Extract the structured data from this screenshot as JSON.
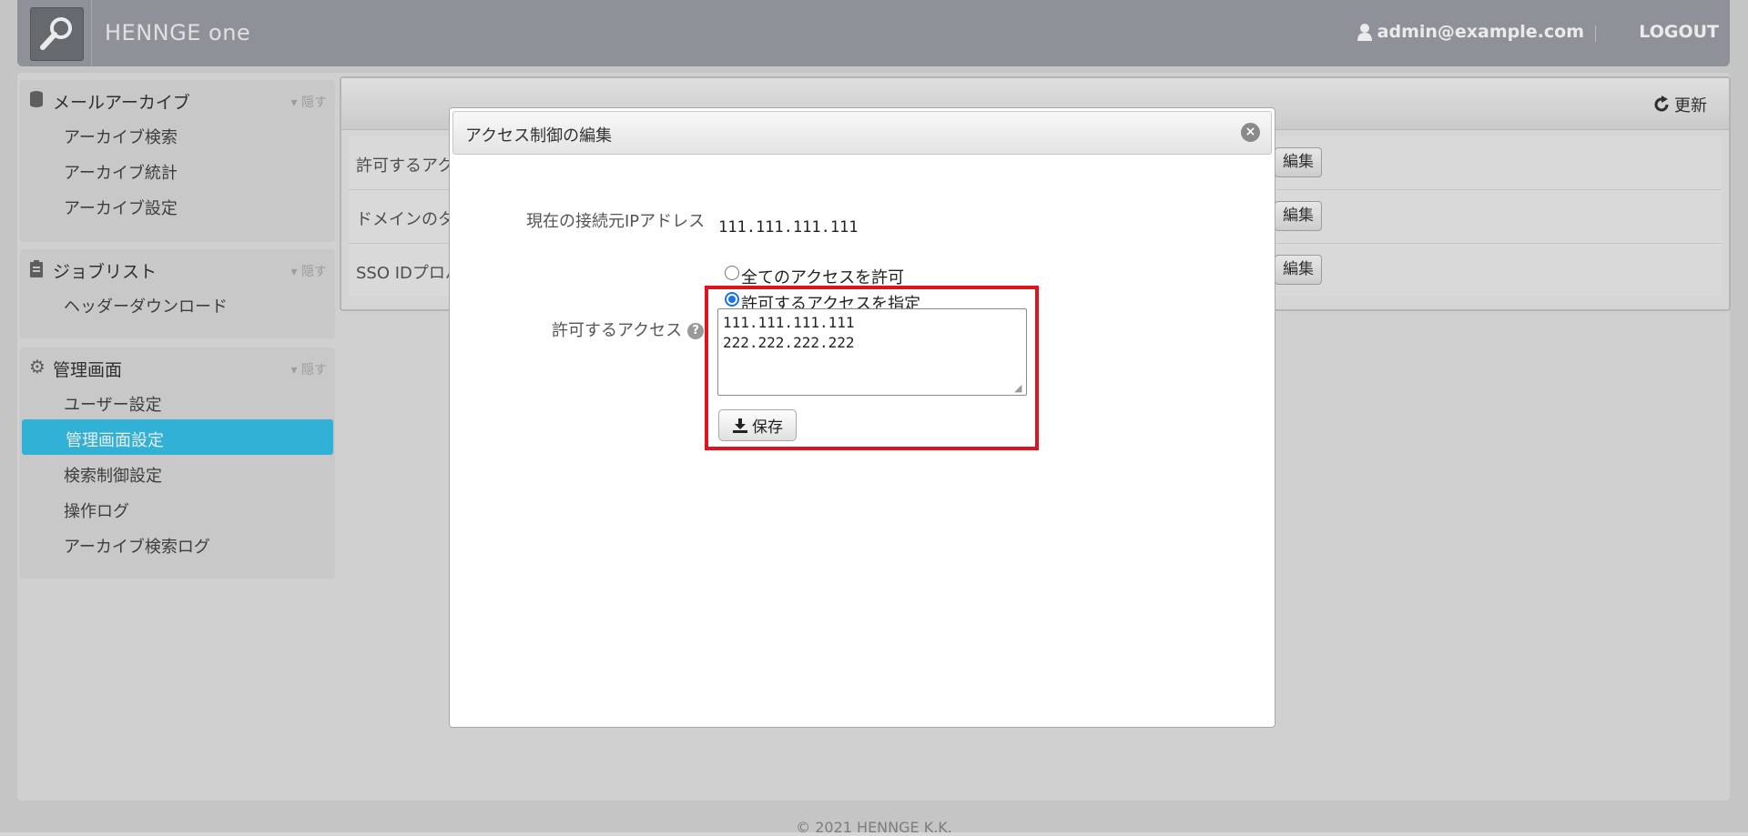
{
  "header": {
    "brand": "HENNGE one",
    "user_email": "admin@example.com",
    "logout_label": "LOGOUT"
  },
  "sidebar": {
    "sections": [
      {
        "title": "メールアーカイブ",
        "icon": "database-icon",
        "hide_label": "隠す",
        "items": [
          "アーカイブ検索",
          "アーカイブ統計",
          "アーカイブ設定"
        ]
      },
      {
        "title": "ジョブリスト",
        "icon": "clipboard-icon",
        "hide_label": "隠す",
        "items": [
          "ヘッダーダウンロード"
        ]
      },
      {
        "title": "管理画面",
        "icon": "gear-icon",
        "hide_label": "隠す",
        "items": [
          "ユーザー設定",
          "管理画面設定",
          "検索制御設定",
          "操作ログ",
          "アーカイブ検索ログ"
        ],
        "active_index": 1
      }
    ]
  },
  "content": {
    "refresh_label": "更新",
    "rows": [
      {
        "label": "許可するアク",
        "edit_label": "編集"
      },
      {
        "label": "ドメインのタ",
        "edit_label": "編集"
      },
      {
        "label": "SSO IDプロバ",
        "edit_label": "編集"
      }
    ]
  },
  "modal": {
    "title": "アクセス制御の編集",
    "current_ip_label": "現在の接続元IPアドレス",
    "current_ip_value": "111.111.111.111",
    "allowed_access_label": "許可するアクセス",
    "radio_all_label": "全てのアクセスを許可",
    "radio_specify_label": "許可するアクセスを指定",
    "selected_radio": "specify",
    "allowed_ips": "111.111.111.111\n222.222.222.222",
    "save_label": "保存"
  },
  "footer": {
    "copyright": "© 2021 HENNGE K.K."
  },
  "colors": {
    "accent": "#35c1e8",
    "header_bg": "#9b9fa5",
    "highlight": "#e0141e"
  }
}
